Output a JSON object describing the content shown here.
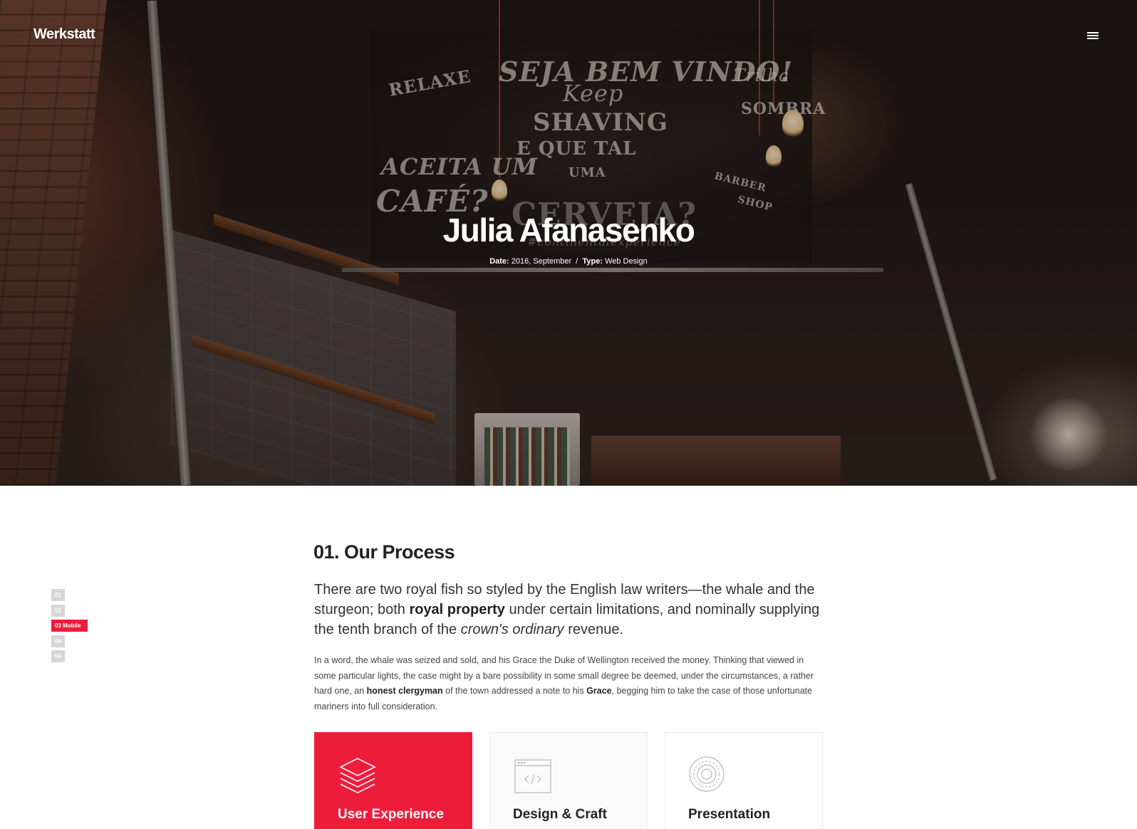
{
  "brand": {
    "name": "Werkstatt"
  },
  "header": {
    "menu_icon": "hamburger-menu-icon"
  },
  "hero": {
    "title": "Julia Afanasenko",
    "date_label": "Date:",
    "date_value": "2016, September",
    "separator": "/",
    "type_label": "Type:",
    "type_value": "Web Design",
    "chalkboard": {
      "relaxe": "RELAXE",
      "welcome": "SEJA BEM VINDO!",
      "keep": "Keep",
      "shaving": "SHAVING",
      "e_que_tal": "E QUE TAL",
      "uma": "UMA",
      "aceita": "ACEITA UM",
      "cafe": "CAFÉ?",
      "cerveja": "CERVEJA?",
      "barber": "BARBER",
      "shop": "SHOP",
      "sombra": "SOMBRA",
      "trilha": "Trilha",
      "hashtag": "#continentalexperience"
    }
  },
  "sidenav": {
    "items": [
      {
        "label": "01",
        "active": false
      },
      {
        "label": "02",
        "active": false
      },
      {
        "label": "03 Mobile",
        "active": true
      },
      {
        "label": "04",
        "active": false
      },
      {
        "label": "04",
        "active": false
      }
    ]
  },
  "section": {
    "title": "01. Our Process",
    "lead_1": "There are two royal fish so styled by the English law writers—the whale and the sturgeon; both ",
    "lead_bold": "royal property",
    "lead_2": " under certain limitations, and nominally supplying the tenth branch of the ",
    "lead_italic": "crown's ordinary",
    "lead_3": " revenue.",
    "body_1": "In a word, the whale was seized and sold, and his Grace the Duke of Wellington received the money. Thinking that viewed in some particular lights, the case might by a bare possibility in some small degree be deemed, under the circumstances, a rather hard one, an ",
    "body_bold_1": "honest clergyman",
    "body_2": " of the town addressed a note to his ",
    "body_bold_2": "Grace",
    "body_3": ", begging him to take the case of those unfortunate mariners into full consideration."
  },
  "cards": [
    {
      "label": "User Experience",
      "icon": "layers-icon",
      "active": true
    },
    {
      "label": "Design & Craft",
      "icon": "code-window-icon",
      "active": false
    },
    {
      "label": "Presentation",
      "icon": "gear-icon",
      "active": false
    }
  ],
  "colors": {
    "accent": "#ee1c3b",
    "inactive_nav": "#d6d6d6",
    "text": "#222222"
  }
}
